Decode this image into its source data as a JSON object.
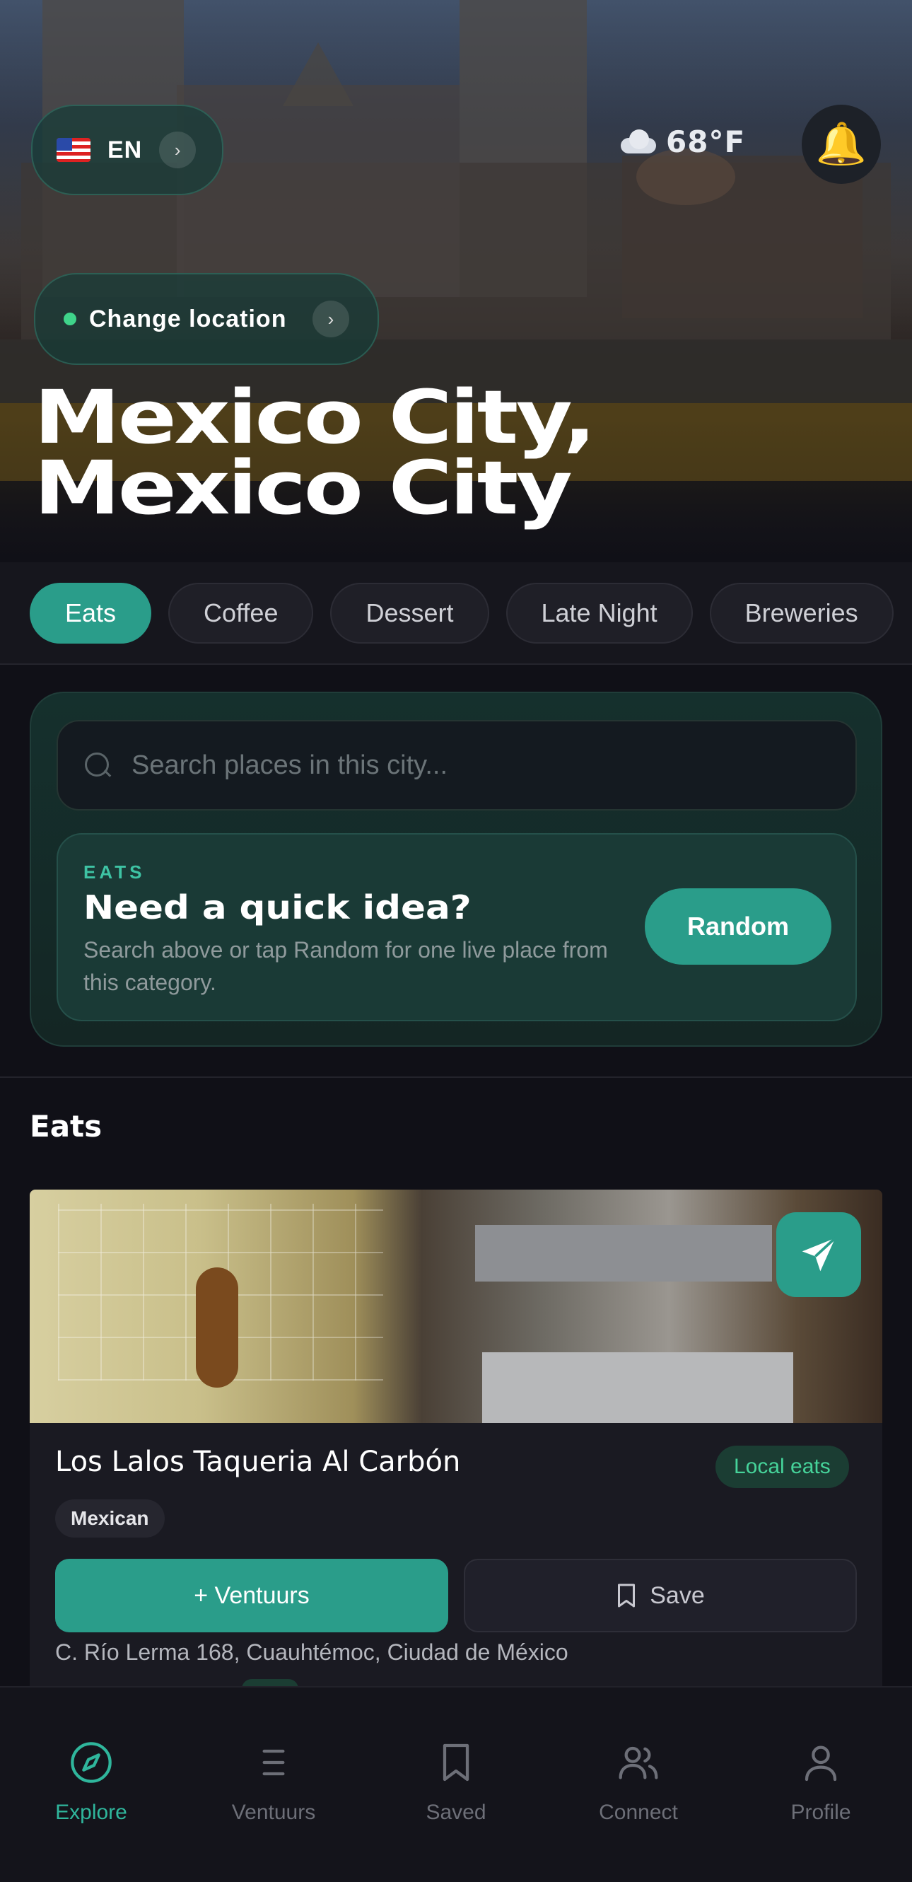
{
  "header": {
    "language": {
      "flag": "us-flag-icon",
      "code": "EN"
    },
    "weather": {
      "icon": "cloud-icon",
      "temperature": "68°F"
    },
    "notifications_icon": "bell-icon",
    "location_button": {
      "label": "Change location",
      "status_color": "#3fd48a"
    },
    "city_line1": "Mexico City,",
    "city_line2": "Mexico City"
  },
  "categories": [
    {
      "label": "Eats",
      "active": true
    },
    {
      "label": "Coffee",
      "active": false
    },
    {
      "label": "Dessert",
      "active": false
    },
    {
      "label": "Late Night",
      "active": false
    },
    {
      "label": "Breweries",
      "active": false
    }
  ],
  "search": {
    "placeholder": "Search places in this city..."
  },
  "quick_idea": {
    "eyebrow": "EATS",
    "title": "Need a quick idea?",
    "subtitle": "Search above or tap Random for one live place from this category.",
    "button": "Random"
  },
  "section": {
    "title": "Eats"
  },
  "places": [
    {
      "name": "Los Lalos Taqueria Al Carbón",
      "badge": "Local eats",
      "tag": "Mexican",
      "add_button": "+ Ventuurs",
      "save_button": "Save",
      "address": "C. Río Lerma 168, Cuauhtémoc, Ciudad de México"
    }
  ],
  "nav": {
    "items": [
      {
        "label": "Explore",
        "icon": "compass-icon",
        "active": true
      },
      {
        "label": "Ventuurs",
        "icon": "list-icon",
        "active": false
      },
      {
        "label": "Saved",
        "icon": "bookmark-icon",
        "active": false
      },
      {
        "label": "Connect",
        "icon": "people-icon",
        "active": false
      },
      {
        "label": "Profile",
        "icon": "person-icon",
        "active": false
      }
    ]
  },
  "colors": {
    "accent": "#2a9d8a",
    "background": "#101017",
    "badge_text": "#46d39a"
  }
}
